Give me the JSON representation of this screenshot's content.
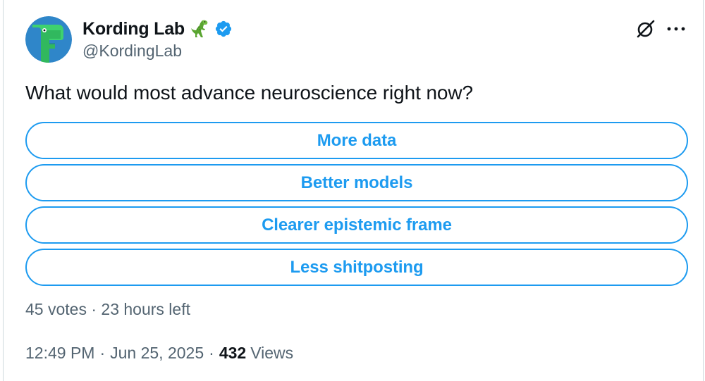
{
  "author": {
    "display_name": "Kording Lab",
    "handle": "@KordingLab",
    "avatar_icon": "dino-logo-icon",
    "emoji_icon": "t-rex-emoji-icon",
    "verified_icon": "verified-badge-icon"
  },
  "toolbar": {
    "grok_icon": "grok-icon",
    "more_icon": "more-options-icon"
  },
  "tweet": {
    "text": "What would most advance neuroscience right now?"
  },
  "poll": {
    "options": [
      {
        "label": "More data"
      },
      {
        "label": "Better models"
      },
      {
        "label": "Clearer epistemic frame"
      },
      {
        "label": "Less shitposting"
      }
    ],
    "votes": "45 votes",
    "separator": "·",
    "time_left": "23 hours left"
  },
  "meta": {
    "time": "12:49 PM",
    "date": "Jun 25, 2025",
    "separator": "·",
    "views_count": "432",
    "views_label": "Views"
  },
  "colors": {
    "accent": "#1d9bf0",
    "text_primary": "#0f1419",
    "text_secondary": "#536471",
    "avatar_bg": "#2f86c9",
    "avatar_fg": "#3ed16f"
  }
}
